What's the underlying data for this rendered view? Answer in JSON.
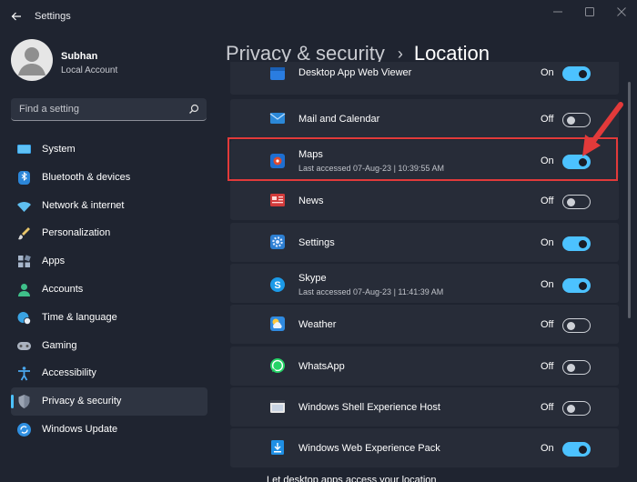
{
  "window": {
    "title": "Settings"
  },
  "user": {
    "name": "Subhan",
    "account_type": "Local Account"
  },
  "search": {
    "placeholder": "Find a setting"
  },
  "sidebar": {
    "items": [
      {
        "label": "System",
        "icon": "display-icon"
      },
      {
        "label": "Bluetooth & devices",
        "icon": "bluetooth-icon"
      },
      {
        "label": "Network & internet",
        "icon": "wifi-icon"
      },
      {
        "label": "Personalization",
        "icon": "brush-icon"
      },
      {
        "label": "Apps",
        "icon": "apps-icon"
      },
      {
        "label": "Accounts",
        "icon": "person-icon"
      },
      {
        "label": "Time & language",
        "icon": "globe-clock-icon"
      },
      {
        "label": "Gaming",
        "icon": "gamepad-icon"
      },
      {
        "label": "Accessibility",
        "icon": "accessibility-icon"
      },
      {
        "label": "Privacy & security",
        "icon": "shield-icon",
        "selected": true
      },
      {
        "label": "Windows Update",
        "icon": "update-icon"
      }
    ]
  },
  "breadcrumb": {
    "parent": "Privacy & security",
    "separator": "›",
    "current": "Location"
  },
  "apps": [
    {
      "name": "Desktop App Web Viewer",
      "state": "On",
      "enabled": true,
      "icon": "web-viewer-icon"
    },
    {
      "name": "Mail and Calendar",
      "state": "Off",
      "enabled": false,
      "icon": "mail-icon"
    },
    {
      "name": "Maps",
      "subtitle": "Last accessed 07-Aug-23  |  10:39:55 AM",
      "state": "On",
      "enabled": true,
      "icon": "maps-icon",
      "highlighted": true
    },
    {
      "name": "News",
      "state": "Off",
      "enabled": false,
      "icon": "news-icon"
    },
    {
      "name": "Settings",
      "state": "On",
      "enabled": true,
      "icon": "settings-gear-icon"
    },
    {
      "name": "Skype",
      "subtitle": "Last accessed 07-Aug-23  |  11:41:39 AM",
      "state": "On",
      "enabled": true,
      "icon": "skype-icon"
    },
    {
      "name": "Weather",
      "state": "Off",
      "enabled": false,
      "icon": "weather-icon"
    },
    {
      "name": "WhatsApp",
      "state": "Off",
      "enabled": false,
      "icon": "whatsapp-icon"
    },
    {
      "name": "Windows Shell Experience Host",
      "state": "Off",
      "enabled": false,
      "icon": "shell-host-icon"
    },
    {
      "name": "Windows Web Experience Pack",
      "state": "On",
      "enabled": true,
      "icon": "web-experience-icon"
    }
  ],
  "footer_partial": "Let desktop apps access your location",
  "colors": {
    "accent": "#4cc2ff",
    "background": "#1f2430",
    "card": "#272c38",
    "highlight_box": "#e23a3a"
  }
}
